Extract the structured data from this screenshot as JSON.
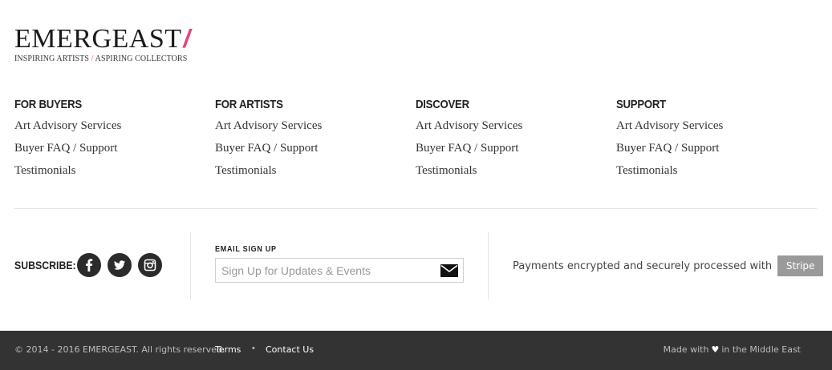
{
  "logo": {
    "word": "EMERGEAST",
    "slash": "/",
    "tag_left": "INSPIRING ARTISTS",
    "tag_sep": "/",
    "tag_right": "ASPIRING COLLECTORS",
    "accent_color": "#e2467f"
  },
  "columns": [
    {
      "title": "FOR BUYERS",
      "links": [
        "Art Advisory Services",
        "Buyer FAQ / Support",
        "Testimonials"
      ]
    },
    {
      "title": "FOR ARTISTS",
      "links": [
        "Art Advisory Services",
        "Buyer FAQ / Support",
        "Testimonials"
      ]
    },
    {
      "title": "DISCOVER",
      "links": [
        "Art Advisory Services",
        "Buyer FAQ / Support",
        "Testimonials"
      ]
    },
    {
      "title": "SUPPORT",
      "links": [
        "Art Advisory Services",
        "Buyer FAQ / Support",
        "Testimonials"
      ]
    }
  ],
  "subscribe": {
    "label": "SUBSCRIBE:",
    "icons": [
      "facebook-icon",
      "twitter-icon",
      "instagram-icon"
    ]
  },
  "signup": {
    "label": "EMAIL SIGN UP",
    "placeholder": "Sign Up for Updates & Events",
    "value": "",
    "button_icon": "envelope-icon"
  },
  "payments": {
    "text": "Payments encrypted and securely processed with",
    "badge": "Stripe"
  },
  "footer": {
    "copyright": "© 2014 - 2016 EMERGEAST. All rights reserved.",
    "terms": "Terms",
    "separator": "•",
    "contact": "Contact Us",
    "made_prefix": "Made with",
    "made_icon": "heart-icon",
    "made_suffix": "in the Middle East",
    "background": "#333333"
  }
}
